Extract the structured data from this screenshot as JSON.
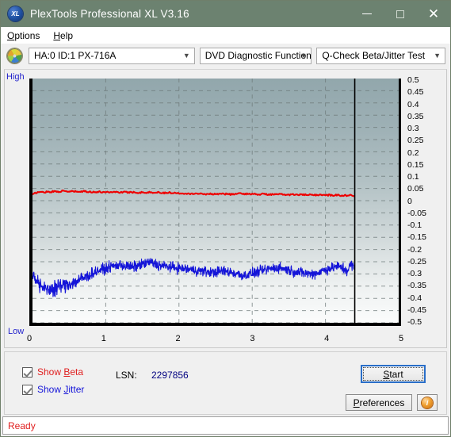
{
  "window": {
    "title": "PlexTools Professional XL V3.16",
    "logo_text": "XL",
    "minimize_label": "Minimize",
    "maximize_label": "Maximize",
    "close_label": "Close",
    "titlebar_color": "#6c8270"
  },
  "menu": {
    "items": [
      {
        "label": "Options",
        "accel": "O"
      },
      {
        "label": "Help",
        "accel": "H"
      }
    ]
  },
  "selectors": {
    "drive": {
      "value": "HA:0 ID:1  PX-716A"
    },
    "function_group": {
      "value": "DVD Diagnostic Functions"
    },
    "test": {
      "value": "Q-Check Beta/Jitter Test"
    }
  },
  "chart_labels": {
    "high": "High",
    "low": "Low"
  },
  "controls": {
    "show_beta": {
      "label": "Show Beta",
      "accel": "B",
      "checked": true,
      "color": "#e02020"
    },
    "show_jitter": {
      "label": "Show Jitter",
      "accel": "J",
      "checked": true,
      "color": "#1414d8"
    },
    "lsn_label": "LSN:",
    "lsn_value": "2297856",
    "start_label": "Start",
    "start_accel": "S",
    "preferences_label": "Preferences",
    "preferences_accel": "P",
    "info_label": "i"
  },
  "status": {
    "message": "Ready",
    "color": "#e02020"
  },
  "chart_data": {
    "type": "line",
    "title": "Q-Check Beta/Jitter Test",
    "xlabel": "",
    "ylabel": "",
    "xlim": [
      0,
      5
    ],
    "ylim": [
      -0.5,
      0.5
    ],
    "grid": true,
    "legend_position": "external-checkboxes",
    "xticks": [
      0,
      1,
      2,
      3,
      4,
      5
    ],
    "yticks": [
      0.5,
      0.45,
      0.4,
      0.35,
      0.3,
      0.25,
      0.2,
      0.15,
      0.1,
      0.05,
      0,
      -0.05,
      -0.1,
      -0.15,
      -0.2,
      -0.25,
      -0.3,
      -0.35,
      -0.4,
      -0.45,
      -0.5
    ],
    "ytick_labels": [
      "0.5",
      "0.45",
      "0.4",
      "0.35",
      "0.3",
      "0.25",
      "0.2",
      "0.15",
      "0.1",
      "0.05",
      "0",
      "-0.05",
      "-0.1",
      "-0.15",
      "-0.2",
      "-0.25",
      "-0.3",
      "-0.35",
      "-0.4",
      "-0.45",
      "-0.5"
    ],
    "xtick_labels": [
      "0",
      "1",
      "2",
      "3",
      "4",
      "5"
    ],
    "data_end_x": 4.4,
    "cursor_line_x": 4.4,
    "series": [
      {
        "name": "Show Beta",
        "color": "#ee0000",
        "x": [
          0.0,
          0.05,
          0.1,
          0.15,
          0.2,
          0.25,
          0.3,
          0.35,
          0.4,
          0.45,
          0.5,
          0.55,
          0.6,
          0.65,
          0.7,
          0.75,
          0.8,
          0.85,
          0.9,
          0.95,
          1.0,
          1.05,
          1.1,
          1.15,
          1.2,
          1.25,
          1.3,
          1.35,
          1.4,
          1.45,
          1.5,
          1.55,
          1.6,
          1.65,
          1.7,
          1.75,
          1.8,
          1.85,
          1.9,
          1.95,
          2.0,
          2.05,
          2.1,
          2.15,
          2.2,
          2.25,
          2.3,
          2.35,
          2.4,
          2.45,
          2.5,
          2.55,
          2.6,
          2.65,
          2.7,
          2.75,
          2.8,
          2.85,
          2.9,
          2.95,
          3.0,
          3.05,
          3.1,
          3.15,
          3.2,
          3.25,
          3.3,
          3.35,
          3.4,
          3.45,
          3.5,
          3.55,
          3.6,
          3.65,
          3.7,
          3.75,
          3.8,
          3.85,
          3.9,
          3.95,
          4.0,
          4.05,
          4.1,
          4.15,
          4.2,
          4.25,
          4.3,
          4.35,
          4.4
        ],
        "y": [
          0.024,
          0.033,
          0.036,
          0.034,
          0.037,
          0.036,
          0.038,
          0.037,
          0.039,
          0.038,
          0.037,
          0.038,
          0.037,
          0.036,
          0.038,
          0.037,
          0.036,
          0.035,
          0.036,
          0.035,
          0.036,
          0.035,
          0.036,
          0.035,
          0.034,
          0.035,
          0.034,
          0.035,
          0.034,
          0.033,
          0.034,
          0.033,
          0.034,
          0.033,
          0.034,
          0.033,
          0.032,
          0.033,
          0.032,
          0.031,
          0.031,
          0.03,
          0.03,
          0.029,
          0.028,
          0.029,
          0.028,
          0.027,
          0.028,
          0.027,
          0.028,
          0.027,
          0.028,
          0.027,
          0.026,
          0.027,
          0.028,
          0.029,
          0.028,
          0.027,
          0.028,
          0.027,
          0.026,
          0.027,
          0.026,
          0.025,
          0.026,
          0.025,
          0.026,
          0.025,
          0.024,
          0.025,
          0.024,
          0.025,
          0.024,
          0.023,
          0.024,
          0.023,
          0.024,
          0.023,
          0.022,
          0.023,
          0.022,
          0.023,
          0.022,
          0.021,
          0.022,
          0.021,
          0.021
        ]
      },
      {
        "name": "Show Jitter",
        "color": "#1414d8",
        "description": "dense noisy band; values are band centre with +/- spread",
        "x": [
          0.0,
          0.05,
          0.1,
          0.15,
          0.2,
          0.25,
          0.3,
          0.35,
          0.4,
          0.45,
          0.5,
          0.55,
          0.6,
          0.65,
          0.7,
          0.75,
          0.8,
          0.85,
          0.9,
          0.95,
          1.0,
          1.05,
          1.1,
          1.15,
          1.2,
          1.25,
          1.3,
          1.35,
          1.4,
          1.45,
          1.5,
          1.55,
          1.6,
          1.65,
          1.7,
          1.75,
          1.8,
          1.85,
          1.9,
          1.95,
          2.0,
          2.05,
          2.1,
          2.15,
          2.2,
          2.25,
          2.3,
          2.35,
          2.4,
          2.45,
          2.5,
          2.55,
          2.6,
          2.65,
          2.7,
          2.75,
          2.8,
          2.85,
          2.9,
          2.95,
          3.0,
          3.05,
          3.1,
          3.15,
          3.2,
          3.25,
          3.3,
          3.35,
          3.4,
          3.45,
          3.5,
          3.55,
          3.6,
          3.65,
          3.7,
          3.75,
          3.8,
          3.85,
          3.9,
          3.95,
          4.0,
          4.05,
          4.1,
          4.15,
          4.2,
          4.25,
          4.3,
          4.35,
          4.4
        ],
        "y": [
          -0.305,
          -0.32,
          -0.345,
          -0.36,
          -0.368,
          -0.362,
          -0.355,
          -0.352,
          -0.348,
          -0.344,
          -0.34,
          -0.336,
          -0.33,
          -0.322,
          -0.316,
          -0.31,
          -0.3,
          -0.292,
          -0.286,
          -0.282,
          -0.278,
          -0.272,
          -0.268,
          -0.266,
          -0.262,
          -0.266,
          -0.27,
          -0.272,
          -0.27,
          -0.266,
          -0.26,
          -0.256,
          -0.252,
          -0.256,
          -0.262,
          -0.266,
          -0.268,
          -0.27,
          -0.272,
          -0.274,
          -0.276,
          -0.278,
          -0.28,
          -0.282,
          -0.284,
          -0.286,
          -0.288,
          -0.29,
          -0.292,
          -0.294,
          -0.292,
          -0.29,
          -0.288,
          -0.29,
          -0.292,
          -0.296,
          -0.3,
          -0.304,
          -0.306,
          -0.302,
          -0.298,
          -0.294,
          -0.29,
          -0.286,
          -0.282,
          -0.278,
          -0.276,
          -0.274,
          -0.276,
          -0.28,
          -0.284,
          -0.288,
          -0.292,
          -0.294,
          -0.296,
          -0.298,
          -0.3,
          -0.298,
          -0.294,
          -0.288,
          -0.282,
          -0.278,
          -0.274,
          -0.27,
          -0.272,
          -0.278,
          -0.286,
          -0.262,
          -0.276
        ],
        "spread": [
          0.03,
          0.034,
          0.042,
          0.048,
          0.05,
          0.048,
          0.046,
          0.046,
          0.044,
          0.044,
          0.042,
          0.042,
          0.04,
          0.04,
          0.038,
          0.036,
          0.034,
          0.032,
          0.03,
          0.03,
          0.03,
          0.03,
          0.03,
          0.03,
          0.03,
          0.03,
          0.032,
          0.032,
          0.032,
          0.03,
          0.03,
          0.03,
          0.03,
          0.032,
          0.032,
          0.032,
          0.03,
          0.03,
          0.03,
          0.03,
          0.03,
          0.03,
          0.03,
          0.03,
          0.03,
          0.03,
          0.03,
          0.03,
          0.03,
          0.03,
          0.03,
          0.03,
          0.03,
          0.03,
          0.03,
          0.03,
          0.03,
          0.03,
          0.03,
          0.03,
          0.03,
          0.03,
          0.03,
          0.03,
          0.03,
          0.03,
          0.03,
          0.03,
          0.03,
          0.03,
          0.03,
          0.03,
          0.03,
          0.03,
          0.03,
          0.03,
          0.03,
          0.03,
          0.03,
          0.03,
          0.03,
          0.03,
          0.03,
          0.03,
          0.032,
          0.034,
          0.04,
          0.034,
          0.03
        ]
      }
    ]
  }
}
